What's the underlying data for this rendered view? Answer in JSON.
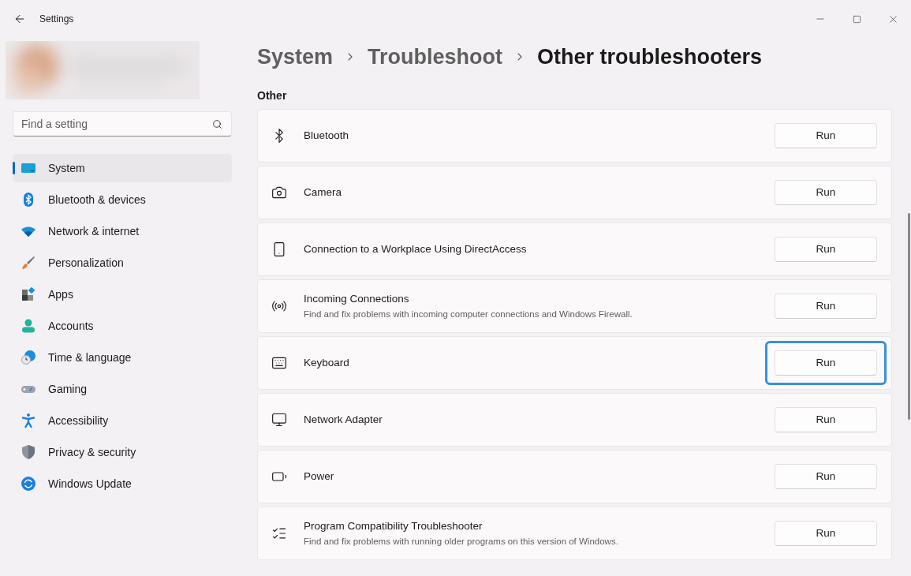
{
  "window": {
    "title": "Settings"
  },
  "search": {
    "placeholder": "Find a setting"
  },
  "sidebar": {
    "items": [
      {
        "label": "System",
        "selected": true
      },
      {
        "label": "Bluetooth & devices",
        "selected": false
      },
      {
        "label": "Network & internet",
        "selected": false
      },
      {
        "label": "Personalization",
        "selected": false
      },
      {
        "label": "Apps",
        "selected": false
      },
      {
        "label": "Accounts",
        "selected": false
      },
      {
        "label": "Time & language",
        "selected": false
      },
      {
        "label": "Gaming",
        "selected": false
      },
      {
        "label": "Accessibility",
        "selected": false
      },
      {
        "label": "Privacy & security",
        "selected": false
      },
      {
        "label": "Windows Update",
        "selected": false
      }
    ]
  },
  "breadcrumb": [
    "System",
    "Troubleshoot",
    "Other troubleshooters"
  ],
  "section": "Other",
  "troubleshooters": [
    {
      "name": "Bluetooth",
      "button": "Run",
      "focused": false
    },
    {
      "name": "Camera",
      "button": "Run",
      "focused": false
    },
    {
      "name": "Connection to a Workplace Using DirectAccess",
      "button": "Run",
      "focused": false
    },
    {
      "name": "Incoming Connections",
      "description": "Find and fix problems with incoming computer connections and Windows Firewall.",
      "button": "Run",
      "focused": false
    },
    {
      "name": "Keyboard",
      "button": "Run",
      "focused": true
    },
    {
      "name": "Network Adapter",
      "button": "Run",
      "focused": false
    },
    {
      "name": "Power",
      "button": "Run",
      "focused": false
    },
    {
      "name": "Program Compatibility Troubleshooter",
      "description": "Find and fix problems with running older programs on this version of Windows.",
      "button": "Run",
      "focused": false
    }
  ]
}
